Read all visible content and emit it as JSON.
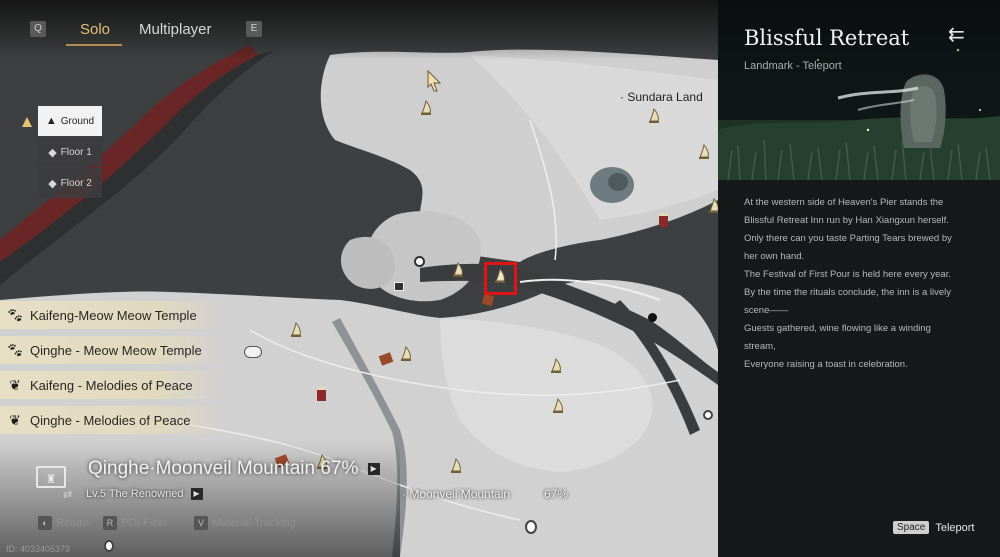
{
  "tabs": {
    "left_key": "Q",
    "solo": "Solo",
    "multiplayer": "Multiplayer",
    "right_key": "E"
  },
  "floors": [
    {
      "label": "Ground",
      "active": true
    },
    {
      "label": "Floor 1",
      "active": false
    },
    {
      "label": "Floor 2",
      "active": false
    }
  ],
  "quests": [
    {
      "label": "Kaifeng-Meow Meow Temple",
      "icon": "paw-icon"
    },
    {
      "label": "Qinghe - Meow Meow Temple",
      "icon": "paw-icon"
    },
    {
      "label": "Kaifeng - Melodies of Peace",
      "icon": "feather-icon"
    },
    {
      "label": "Qinghe - Melodies of Peace",
      "icon": "feather-icon"
    }
  ],
  "region": {
    "title": "Qinghe·Moonveil Mountain 67%",
    "level": "Lv.5 The Renowned"
  },
  "hints": [
    {
      "key": "",
      "label": "Return"
    },
    {
      "key": "R",
      "label": "POI Filter"
    },
    {
      "key": "V",
      "label": "Material Tracking"
    }
  ],
  "player_id": "ID: 4033405379",
  "map_labels": {
    "sundara": "Sundara Land",
    "moonveil": "Moonveil Mountain",
    "moonveil_pct": "67%"
  },
  "panel": {
    "title": "Blissful Retreat",
    "subtitle": "Landmark - Teleport",
    "description": [
      "At the western side of Heaven's Pier stands the",
      "Blissful Retreat Inn run by Han Xiangxun herself.",
      "Only there can you taste Parting Tears brewed by",
      "her own hand.",
      "The Festival of First Pour is held here every year.",
      "By the time the rituals conclude, the inn is a lively",
      "scene——",
      "Guests gathered, wine flowing like a winding",
      "stream,",
      "Everyone raising a toast in celebration."
    ],
    "teleport_key": "Space",
    "teleport_label": "Teleport"
  },
  "colors": {
    "accent_gold": "#e2c27a",
    "selection_red": "#e01414",
    "quest_bg": "#e8e0c4"
  }
}
